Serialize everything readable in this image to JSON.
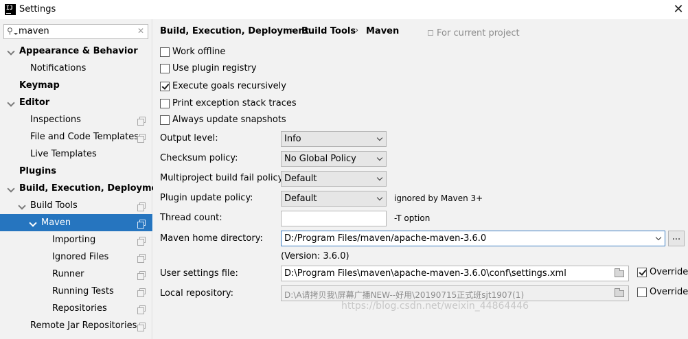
{
  "window": {
    "title": "Settings",
    "logo_text": "IJ"
  },
  "search": {
    "value": "maven"
  },
  "tree": [
    {
      "label": "Appearance & Behavior",
      "bold": true,
      "expandable": true,
      "expanded": true,
      "indent": 0
    },
    {
      "label": "Notifications",
      "bold": false,
      "indent": 1
    },
    {
      "label": "Keymap",
      "bold": true,
      "indent": 0
    },
    {
      "label": "Editor",
      "bold": true,
      "expandable": true,
      "expanded": true,
      "indent": 0
    },
    {
      "label": "Inspections",
      "bold": false,
      "indent": 1,
      "project": true
    },
    {
      "label": "File and Code Templates",
      "bold": false,
      "indent": 1,
      "project": true
    },
    {
      "label": "Live Templates",
      "bold": false,
      "indent": 1
    },
    {
      "label": "Plugins",
      "bold": true,
      "indent": 0
    },
    {
      "label": "Build, Execution, Deployment",
      "bold": true,
      "expandable": true,
      "expanded": true,
      "indent": 0
    },
    {
      "label": "Build Tools",
      "bold": false,
      "expandable": true,
      "expanded": true,
      "indent": 1,
      "project": true
    },
    {
      "label": "Maven",
      "bold": false,
      "expandable": true,
      "expanded": true,
      "indent": 2,
      "project": true,
      "selected": true
    },
    {
      "label": "Importing",
      "bold": false,
      "indent": 3,
      "project": true
    },
    {
      "label": "Ignored Files",
      "bold": false,
      "indent": 3,
      "project": true
    },
    {
      "label": "Runner",
      "bold": false,
      "indent": 3,
      "project": true
    },
    {
      "label": "Running Tests",
      "bold": false,
      "indent": 3,
      "project": true
    },
    {
      "label": "Repositories",
      "bold": false,
      "indent": 3,
      "project": true
    },
    {
      "label": "Remote Jar Repositories",
      "bold": false,
      "indent": 1,
      "project": true
    }
  ],
  "breadcrumb": {
    "items": [
      "Build, Execution, Deployment",
      "Build Tools",
      "Maven"
    ],
    "separator": "›",
    "scope": "For current project"
  },
  "checkboxes": {
    "work_offline": {
      "label": "Work offline",
      "checked": false
    },
    "plugin_registry": {
      "label": "Use plugin registry",
      "checked": false
    },
    "execute_goals": {
      "label": "Execute goals recursively",
      "checked": true
    },
    "print_exceptions": {
      "label": "Print exception stack traces",
      "checked": false
    },
    "update_snapshots": {
      "label": "Always update snapshots",
      "checked": false
    }
  },
  "fields": {
    "output_level": {
      "label": "Output level:",
      "value": "Info"
    },
    "checksum_policy": {
      "label": "Checksum policy:",
      "value": "No Global Policy"
    },
    "multiproject_policy": {
      "label": "Multiproject build fail policy:",
      "value": "Default"
    },
    "plugin_update_policy": {
      "label": "Plugin update policy:",
      "value": "Default",
      "hint": "ignored by Maven 3+"
    },
    "thread_count": {
      "label": "Thread count:",
      "value": "",
      "hint": "-T option"
    },
    "maven_home": {
      "label": "Maven home directory:",
      "value": "D:/Program Files/maven/apache-maven-3.6.0",
      "browse": "...",
      "version": "(Version: 3.6.0)"
    },
    "user_settings": {
      "label": "User settings file:",
      "value": "D:\\Program Files\\maven\\apache-maven-3.6.0\\conf\\settings.xml",
      "override_label": "Override",
      "override": true
    },
    "local_repository": {
      "label": "Local repository:",
      "value": "D:\\A请拷贝我\\屏幕广播NEW--好用\\20190715正式班sjt1907(1)",
      "override_label": "Override",
      "override": false
    }
  },
  "watermark": "https://blog.csdn.net/weixin_44864446"
}
